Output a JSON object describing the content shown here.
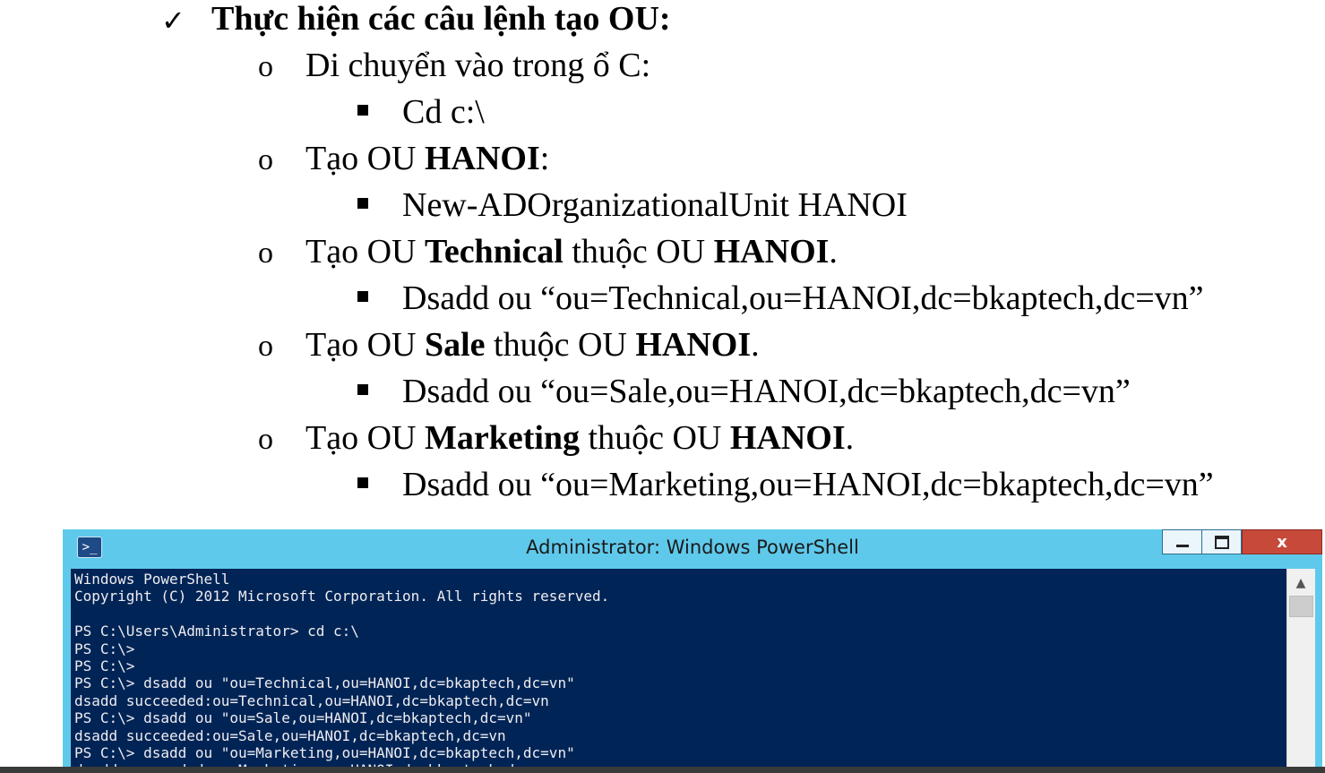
{
  "doc": {
    "heading": "Thực hiện các câu lệnh tạo OU:",
    "steps": [
      {
        "parts": [
          "Di chuyển vào trong ổ C:"
        ],
        "command": "Cd  c:\\"
      },
      {
        "parts": [
          "Tạo OU ",
          "HANOI",
          ":"
        ],
        "command": "New-ADOrganizationalUnit  HANOI"
      },
      {
        "parts": [
          "Tạo OU ",
          "Technical",
          " thuộc OU ",
          "HANOI",
          "."
        ],
        "command": "Dsadd  ou  “ou=Technical,ou=HANOI,dc=bkaptech,dc=vn”"
      },
      {
        "parts": [
          "Tạo OU ",
          "Sale",
          " thuộc OU ",
          "HANOI",
          "."
        ],
        "command": "Dsadd  ou  “ou=Sale,ou=HANOI,dc=bkaptech,dc=vn”"
      },
      {
        "parts": [
          "Tạo OU ",
          "Marketing",
          " thuộc OU ",
          "HANOI",
          "."
        ],
        "command": "Dsadd  ou  “ou=Marketing,ou=HANOI,dc=bkaptech,dc=vn”"
      }
    ]
  },
  "window": {
    "title": "Administrator: Windows PowerShell",
    "close_label": "x",
    "colors": {
      "titlebar": "#5fc9eb",
      "console_bg": "#012456",
      "console_fg": "#eeedf0",
      "close": "#c7493a"
    }
  },
  "console": {
    "lines": [
      "Windows PowerShell",
      "Copyright (C) 2012 Microsoft Corporation. All rights reserved.",
      "",
      "PS C:\\Users\\Administrator> cd c:\\",
      "PS C:\\>",
      "PS C:\\>",
      "PS C:\\> dsadd ou \"ou=Technical,ou=HANOI,dc=bkaptech,dc=vn\"",
      "dsadd succeeded:ou=Technical,ou=HANOI,dc=bkaptech,dc=vn",
      "PS C:\\> dsadd ou \"ou=Sale,ou=HANOI,dc=bkaptech,dc=vn\"",
      "dsadd succeeded:ou=Sale,ou=HANOI,dc=bkaptech,dc=vn",
      "PS C:\\> dsadd ou \"ou=Marketing,ou=HANOI,dc=bkaptech,dc=vn\"",
      "dsadd succeeded:ou=Marketing,ou=HANOI,dc=bkaptech,dc=vn"
    ]
  },
  "icons": {
    "check": "check-icon",
    "app": "powershell-icon",
    "scroll_up": "scroll-up-icon"
  }
}
